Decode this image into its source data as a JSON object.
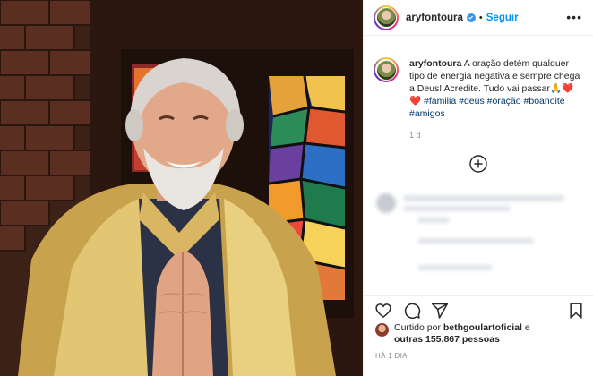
{
  "post": {
    "username": "aryfontoura",
    "follow_label": "Seguir",
    "separator": "•",
    "more_label": "•••",
    "caption_text": "A oração detém qualquer tipo de energia negativa e sempre chega a Deus! Acredite. Tudo vai passar",
    "caption_emojis": "🙏❤️❤️",
    "hashtags": [
      "#familia",
      "#deus",
      "#oração",
      "#boanoite",
      "#amigos"
    ],
    "age": "1 d",
    "liked_by_prefix": "Curtido por",
    "liked_by_user": "bethgoulartoficial",
    "liked_by_joiner": "e",
    "liked_by_others": "outras 155.867 pessoas",
    "posted_time": "HÁ 1 DIA"
  },
  "icons": {
    "verified": "verified-badge-icon",
    "more": "more-options-icon",
    "load_comments": "plus-circle-icon",
    "like": "heart-icon",
    "comment": "comment-icon",
    "share": "share-icon",
    "save": "bookmark-icon"
  },
  "colors": {
    "link_blue": "#0095f6",
    "hashtag": "#00376b",
    "verified": "#3897f0",
    "muted": "#8e8e8e"
  }
}
